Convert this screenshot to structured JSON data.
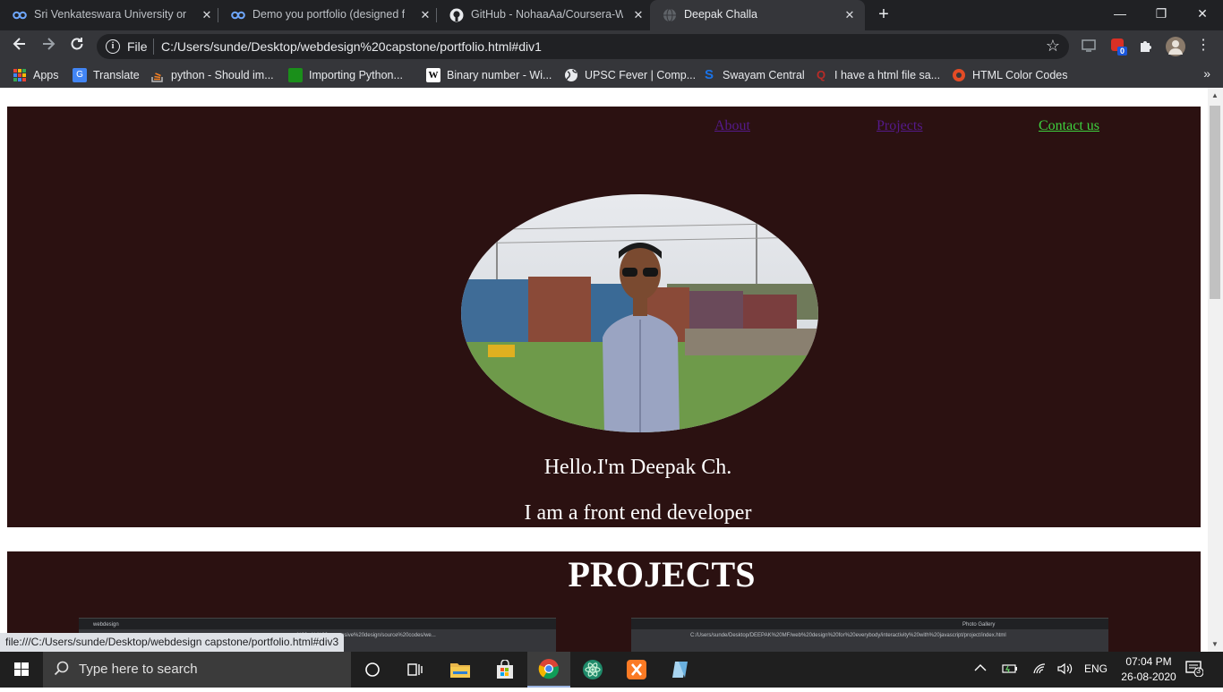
{
  "browser": {
    "tabs": [
      {
        "title": "Sri Venkateswara University on Co",
        "icon": "coursera-icon",
        "active": false
      },
      {
        "title": "Demo you portfolio (designed fro",
        "icon": "coursera-icon",
        "active": false
      },
      {
        "title": "GitHub - NohaaAa/Coursera-Web",
        "icon": "github-icon",
        "active": false
      },
      {
        "title": "Deepak Challa",
        "icon": "globe-icon",
        "active": true
      }
    ],
    "new_tab": "+",
    "window_controls": {
      "minimize": "—",
      "restore": "❐",
      "close": "✕"
    },
    "omnibox": {
      "scheme_label": "File",
      "url": "C:/Users/sunde/Desktop/webdesign%20capstone/portfolio.html#div1"
    },
    "extension_badge": "0",
    "bookmarks": [
      {
        "label": "Apps",
        "icon": "apps-grid-icon"
      },
      {
        "label": "Translate",
        "icon": "translate-icon"
      },
      {
        "label": "python - Should im...",
        "icon": "stackoverflow-icon"
      },
      {
        "label": "Importing Python...",
        "icon": "green-square-icon"
      },
      {
        "label": "Binary number - Wi...",
        "icon": "wikipedia-icon"
      },
      {
        "label": "UPSC Fever | Comp...",
        "icon": "globe-icon"
      },
      {
        "label": "Swayam Central",
        "icon": "swayam-icon"
      },
      {
        "label": "I have a html file sa...",
        "icon": "quora-icon"
      },
      {
        "label": "HTML Color Codes",
        "icon": "color-codes-icon"
      }
    ],
    "bookmarks_more": "»",
    "status_url": "file:///C:/Users/sunde/Desktop/webdesign capstone/portfolio.html#div3"
  },
  "page": {
    "nav": {
      "about": "About",
      "projects": "Projects",
      "contact": "Contact us"
    },
    "hello": "Hello.I'm Deepak Ch.",
    "role": "I am a front end developer",
    "projects_heading": "PROJECTS",
    "thumbs": [
      {
        "tab_title": "webdesign",
        "url": "q%20with%20responsive%20design/source%20codes/we..."
      },
      {
        "tab_title": "Photo Gallery",
        "url": "C:/Users/sunde/Desktop/DEEPAK%20MF/web%20design%20for%20everybody/interactivity%20with%20javascript/project/index.html"
      }
    ]
  },
  "taskbar": {
    "search_placeholder": "Type here to search",
    "language": "ENG",
    "time": "07:04 PM",
    "date": "26-08-2020",
    "notification_count": "3"
  },
  "colors": {
    "hero_bg": "#2b1111",
    "contact_link": "#3ed13e",
    "visited_link": "#551a8b"
  }
}
